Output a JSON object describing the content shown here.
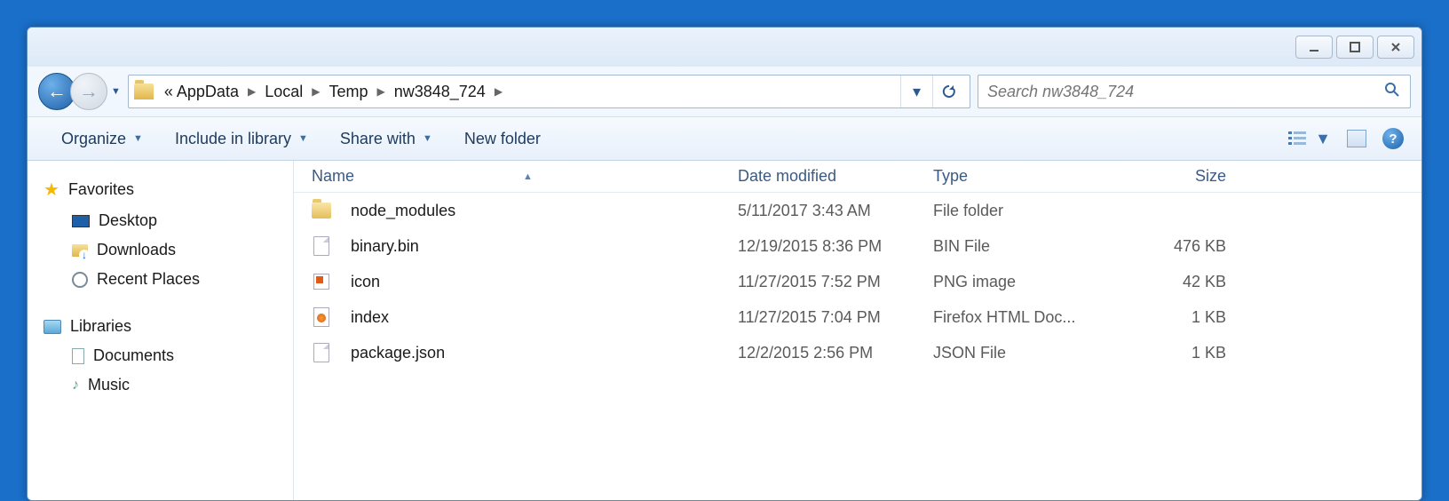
{
  "breadcrumbs": {
    "prefix": "«",
    "segments": [
      "AppData",
      "Local",
      "Temp",
      "nw3848_724"
    ]
  },
  "search": {
    "placeholder": "Search nw3848_724"
  },
  "toolbar": {
    "organize": "Organize",
    "include": "Include in library",
    "share": "Share with",
    "newFolder": "New folder"
  },
  "columns": {
    "name": "Name",
    "date": "Date modified",
    "type": "Type",
    "size": "Size"
  },
  "sidebar": {
    "favorites": "Favorites",
    "desktop": "Desktop",
    "downloads": "Downloads",
    "recent": "Recent Places",
    "libraries": "Libraries",
    "documents": "Documents",
    "music": "Music"
  },
  "files": [
    {
      "name": "node_modules",
      "date": "5/11/2017 3:43 AM",
      "type": "File folder",
      "size": "",
      "icon": "folder"
    },
    {
      "name": "binary.bin",
      "date": "12/19/2015 8:36 PM",
      "type": "BIN File",
      "size": "476 KB",
      "icon": "file"
    },
    {
      "name": "icon",
      "date": "11/27/2015 7:52 PM",
      "type": "PNG image",
      "size": "42 KB",
      "icon": "png"
    },
    {
      "name": "index",
      "date": "11/27/2015 7:04 PM",
      "type": "Firefox HTML Doc...",
      "size": "1 KB",
      "icon": "html"
    },
    {
      "name": "package.json",
      "date": "12/2/2015 2:56 PM",
      "type": "JSON File",
      "size": "1 KB",
      "icon": "file"
    }
  ]
}
